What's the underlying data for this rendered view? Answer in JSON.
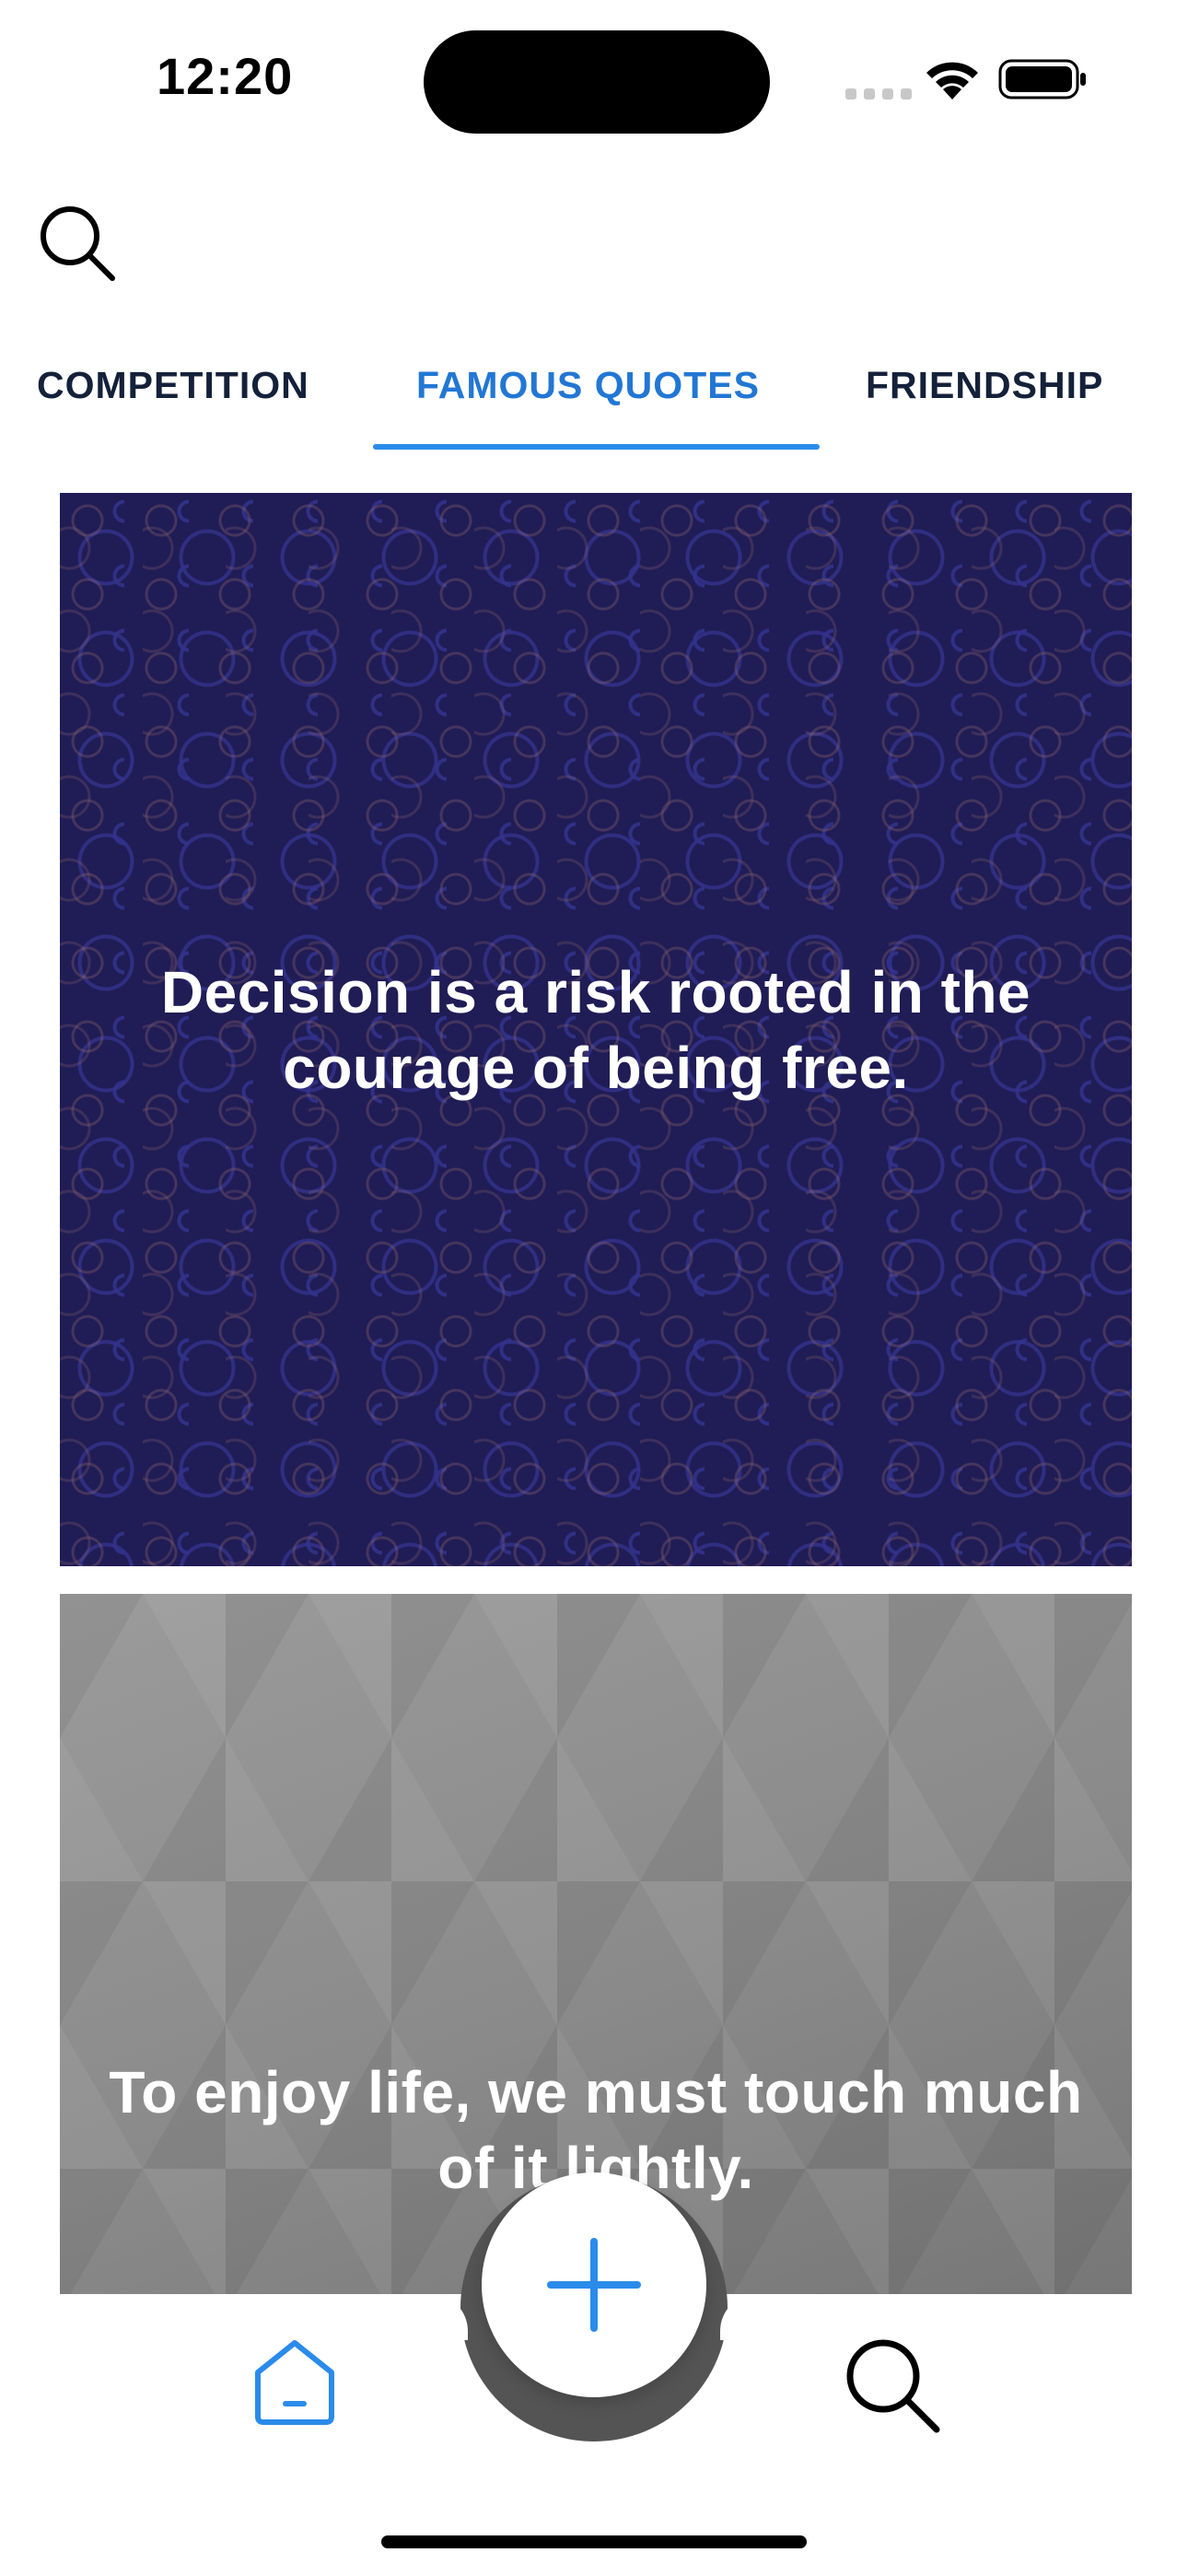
{
  "status_bar": {
    "time": "12:20"
  },
  "header": {
    "search_icon": "search-icon"
  },
  "tabs": [
    {
      "label": "COMPETITION",
      "selected": false
    },
    {
      "label": "FAMOUS QUOTES",
      "selected": true
    },
    {
      "label": "FRIENDSHIP",
      "selected": false
    }
  ],
  "quotes": [
    {
      "text": "Decision is a risk rooted in the courage of being free.",
      "background": "#201c55"
    },
    {
      "text": "To enjoy life, we must touch much of it lightly.",
      "background": "#8f8f8f"
    }
  ],
  "bottom_nav": {
    "home_icon": "home-icon",
    "add_icon": "plus-icon",
    "search_icon": "search-icon"
  },
  "colors": {
    "accent": "#2a8bea",
    "active_tab_text": "#2277d4",
    "tab_text": "#14213a"
  }
}
